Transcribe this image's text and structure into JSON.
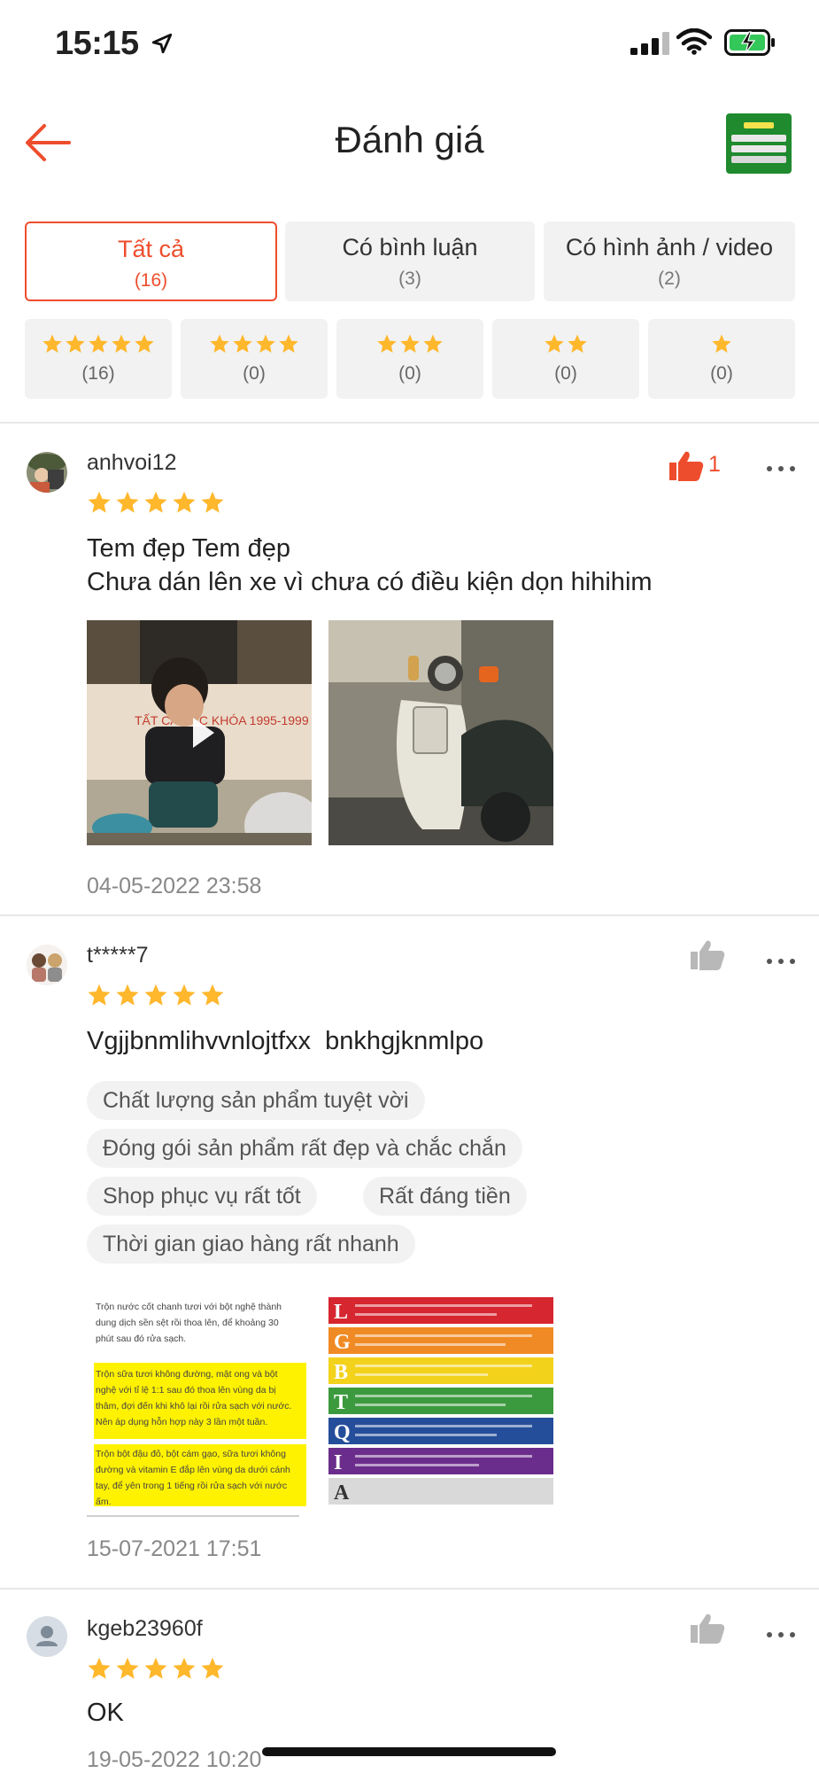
{
  "status_bar": {
    "time": "15:15"
  },
  "header": {
    "title": "Đánh giá"
  },
  "filter_tabs": [
    {
      "label": "Tất cả",
      "count": "(16)",
      "active": true
    },
    {
      "label": "Có bình luận",
      "count": "(3)",
      "active": false
    },
    {
      "label": "Có hình ảnh / video",
      "count": "(2)",
      "active": false
    }
  ],
  "star_filters": [
    {
      "stars": 5,
      "count": "(16)"
    },
    {
      "stars": 4,
      "count": "(0)"
    },
    {
      "stars": 3,
      "count": "(0)"
    },
    {
      "stars": 2,
      "count": "(0)"
    },
    {
      "stars": 1,
      "count": "(0)"
    }
  ],
  "reviews": [
    {
      "username": "anhvoi12",
      "rating": 5,
      "liked": true,
      "like_count": "1",
      "text_lines": [
        "Tem đẹp Tem đẹp",
        "Chưa dán lên xe vì chưa có điều kiện dọn hihihim"
      ],
      "date": "04-05-2022 23:58"
    },
    {
      "username": "t*****7",
      "rating": 5,
      "liked": false,
      "text_lines": [
        "Vgjjbnmlihvvnlojtfxx  bnkhgjknmlpo"
      ],
      "tags": [
        "Chất lượng sản phẩm tuyệt vời",
        "Đóng gói sản phẩm rất đẹp và chắc chắn",
        "Shop phục vụ rất tốt",
        "Rất đáng tiền",
        "Thời gian giao hàng rất nhanh"
      ],
      "date": "15-07-2021 17:51"
    },
    {
      "username": "kgeb23960f",
      "rating": 5,
      "liked": false,
      "text_lines": [
        "OK"
      ],
      "date": "19-05-2022 10:20"
    }
  ],
  "media_images": {
    "banner_text": "TẤT CẢ CÁC KHÓA 1995-1999",
    "doc_lines": [
      "Trộn nước cốt chanh tươi với bột nghệ thành",
      "dung dịch sền sệt rồi thoa lên, để khoảng 30",
      "phút sau đó rửa sạch.",
      "Trộn sữa tươi không đường, mật ong và bột",
      "nghệ với tỉ lệ 1:1 sau đó thoa lên vùng da bị",
      "thâm, đợi đến khi khô lại rồi rửa sạch với nước.",
      "Nên áp dụng hỗn hợp này 3 lần một tuần.",
      "Trộn bột đậu đỏ, bột cám gạo, sữa tươi không",
      "đường và vitamin E đắp lên vùng da dưới cánh",
      "tay, để yên trong 1 tiếng rồi rửa sạch với nước",
      "ấm."
    ],
    "letters": [
      "L",
      "G",
      "B",
      "T",
      "Q",
      "I",
      "A"
    ]
  },
  "colors": {
    "accent": "#ee4d2d",
    "star": "#ffb72c",
    "chip_bg": "#f2f2f2"
  }
}
